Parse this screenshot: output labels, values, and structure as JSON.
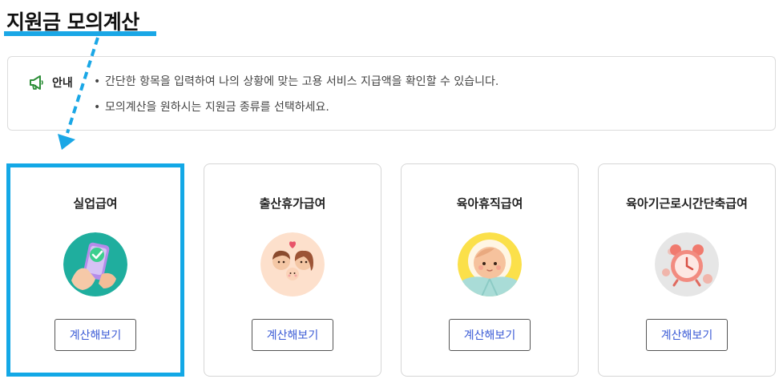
{
  "page": {
    "title": "지원금 모의계산"
  },
  "notice": {
    "label": "안내",
    "icon": "megaphone-icon",
    "items": [
      "간단한 항목을 입력하여 나의 상황에 맞는 고용 서비스 지급액을 확인할 수 있습니다.",
      "모의계산을 원하시는 지원금 종류를 선택하세요."
    ]
  },
  "cards": [
    {
      "title": "실업급여",
      "button": "계산해보기",
      "icon": "phone-check-hand-icon",
      "selected": true
    },
    {
      "title": "출산휴가급여",
      "button": "계산해보기",
      "icon": "family-baby-icon",
      "selected": false
    },
    {
      "title": "육아휴직급여",
      "button": "계산해보기",
      "icon": "swaddled-baby-icon",
      "selected": false
    },
    {
      "title": "육아기근로시간단축급여",
      "button": "계산해보기",
      "icon": "alarm-clock-icon",
      "selected": false
    }
  ],
  "colors": {
    "accent": "#13a8e6",
    "button_text": "#3b5bd6",
    "notice_icon": "#2f8f3a"
  }
}
